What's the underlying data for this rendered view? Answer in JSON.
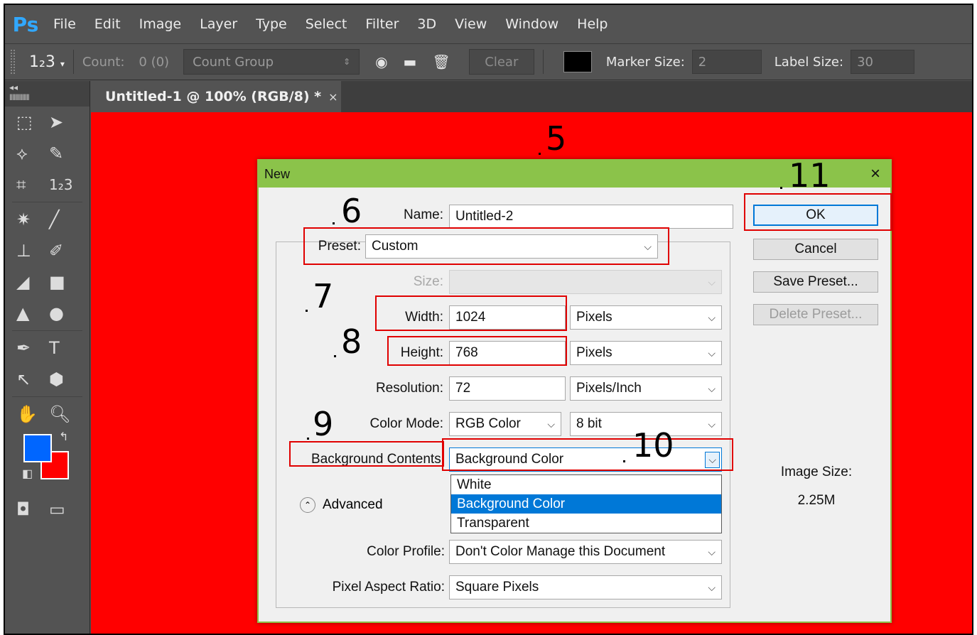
{
  "app": {
    "logo": "Ps",
    "menu": [
      "File",
      "Edit",
      "Image",
      "Layer",
      "Type",
      "Select",
      "Filter",
      "3D",
      "View",
      "Window",
      "Help"
    ]
  },
  "options_bar": {
    "tool_glyph": "1₂3",
    "count_label": "Count:",
    "count_value": "0 (0)",
    "count_group": "Count Group",
    "clear_label": "Clear",
    "marker_size_label": "Marker Size:",
    "marker_size_value": "2",
    "label_size_label": "Label Size:",
    "label_size_value": "30"
  },
  "document": {
    "tab_title": "Untitled-1 @ 100% (RGB/8) *",
    "tab_close": "×"
  },
  "dialog": {
    "title": "New",
    "close": "×",
    "name_label": "Name:",
    "name_value": "Untitled-2",
    "preset_label": "Preset:",
    "preset_value": "Custom",
    "size_label": "Size:",
    "width_label": "Width:",
    "width_value": "1024",
    "width_unit": "Pixels",
    "height_label": "Height:",
    "height_value": "768",
    "height_unit": "Pixels",
    "resolution_label": "Resolution:",
    "resolution_value": "72",
    "resolution_unit": "Pixels/Inch",
    "color_mode_label": "Color Mode:",
    "color_mode_value": "RGB Color",
    "bit_depth_value": "8 bit",
    "background_label": "Background Contents:",
    "background_value": "Background Color",
    "background_options": [
      "White",
      "Background Color",
      "Transparent"
    ],
    "advanced_label": "Advanced",
    "color_profile_label": "Color Profile:",
    "color_profile_value": "Don't Color Manage this Document",
    "pixel_aspect_label": "Pixel Aspect Ratio:",
    "pixel_aspect_value": "Square Pixels",
    "buttons": {
      "ok": "OK",
      "cancel": "Cancel",
      "save_preset": "Save Preset...",
      "delete_preset": "Delete Preset..."
    },
    "image_size_label": "Image Size:",
    "image_size_value": "2.25M"
  },
  "annotations": [
    "5",
    "6",
    "7",
    "8",
    "9",
    "10",
    "11"
  ],
  "colors": {
    "canvas": "#ff0000",
    "foreground": "#0066ff",
    "background": "#ff0000",
    "dialog_titlebar": "#8bc34a",
    "annotation_box": "#e00000"
  }
}
